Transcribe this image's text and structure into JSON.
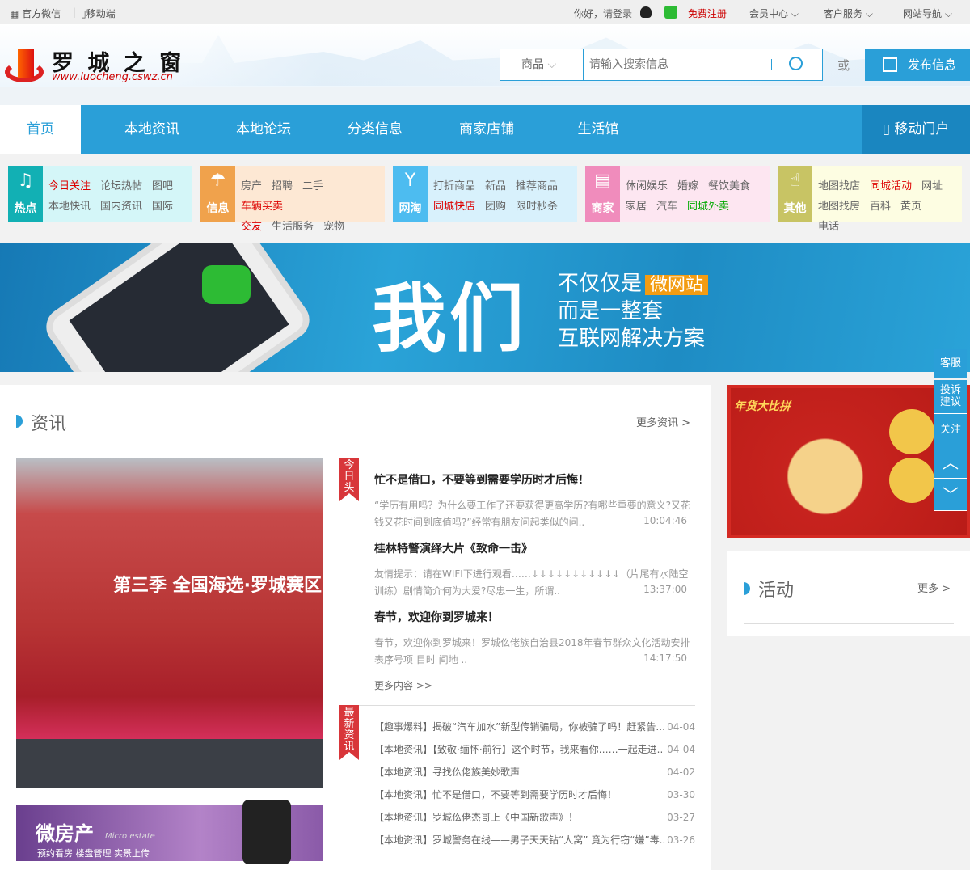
{
  "topbar": {
    "wechat": "官方微信",
    "mobile": "移动端",
    "greeting": "你好，请登录",
    "register": "免费注册",
    "member": "会员中心",
    "service": "客户服务",
    "sitenav": "网站导航"
  },
  "logo": {
    "name": "罗 城 之 窗",
    "url": "www.luocheng.cswz.cn"
  },
  "search": {
    "category": "商品",
    "placeholder": "请输入搜索信息",
    "or": "或",
    "publish": "发布信息"
  },
  "nav": {
    "items": [
      "首页",
      "本地资讯",
      "本地论坛",
      "分类信息",
      "商家店铺",
      "生活馆"
    ],
    "mobile": "移动门户"
  },
  "categories": [
    {
      "label": "热点",
      "links": [
        [
          "今日关注",
          "论坛热帖",
          "图吧"
        ],
        [
          "本地快讯",
          "国内资讯",
          "国际"
        ]
      ]
    },
    {
      "label": "信息",
      "links": [
        [
          "房产",
          "招聘",
          "二手",
          "车辆买卖"
        ],
        [
          "交友",
          "生活服务",
          "宠物"
        ]
      ]
    },
    {
      "label": "网淘",
      "links": [
        [
          "打折商品",
          "新品",
          "推荐商品"
        ],
        [
          "同城快店",
          "团购",
          "限时秒杀"
        ]
      ]
    },
    {
      "label": "商家",
      "links": [
        [
          "休闲娱乐",
          "婚嫁",
          "餐饮美食"
        ],
        [
          "家居",
          "汽车",
          "同城外卖"
        ]
      ]
    },
    {
      "label": "其他",
      "links": [
        [
          "地图找店",
          "同城活动",
          "网址"
        ],
        [
          "地图找房",
          "百科",
          "黄页",
          "电话"
        ]
      ]
    }
  ],
  "banner": {
    "big": "我们",
    "line1": "不仅仅是",
    "tag": "微网站",
    "line2": "而是一整套",
    "line3": "互联网解决方案"
  },
  "news": {
    "title": "资讯",
    "more": "更多资讯 >",
    "ribbon1": "今日头条",
    "ribbon2": "最新资讯",
    "headlines": [
      {
        "title": "忙不是借口，不要等到需要学历时才后悔！",
        "desc": "“学历有用吗？为什么要工作了还要获得更高学历?有哪些重要的意义?又花钱又花时间到底值吗?”经常有朋友问起类似的问..",
        "time": "10:04:46"
      },
      {
        "title": "桂林特警演绎大片《致命一击》",
        "desc": "友情提示：请在WIFI下进行观看……↓↓↓↓↓↓↓↓↓↓↓（片尾有水陆空训练）剧情简介何为大爱?尽忠一生，所谓..",
        "time": "13:37:00"
      },
      {
        "title": "春节，欢迎你到罗城来！",
        "desc": "春节，欢迎你到罗城来！罗城仫佬族自治县2018年春节群众文化活动安排表序号项 目时 间地 ..",
        "time": "14:17:50"
      }
    ],
    "more_content": "更多内容 >>",
    "latest": [
      {
        "text": "【趣事爆料】揭破“汽车加水”新型传销骗局，你被骗了吗！赶紧告...",
        "date": "04-04"
      },
      {
        "text": "【本地资讯】【致敬·缅怀·前行】这个时节，我来看你……一起走进..",
        "date": "04-04"
      },
      {
        "text": "【本地资讯】寻找仫佬族美妙歌声",
        "date": "04-02"
      },
      {
        "text": "【本地资讯】忙不是借口，不要等到需要学历时才后悔！",
        "date": "03-30"
      },
      {
        "text": "【本地资讯】罗城仫佬杰哥上《中国新歌声》！",
        "date": "03-27"
      },
      {
        "text": "【本地资讯】罗城警务在线——男子天天钻“人窝” 竟为行窃“嫌”毒..",
        "date": "03-26"
      }
    ],
    "photo_caption": "第三季 全国海选·罗城赛区",
    "ad2": {
      "title": "微房产",
      "sub": "Micro estate",
      "desc": "预约看房 楼盘管理 实景上传"
    }
  },
  "ad": {
    "title": "年货大比拼"
  },
  "activity": {
    "title": "活动",
    "more": "更多 >"
  },
  "float": {
    "service": "客服",
    "complain": "投诉建议",
    "follow": "关注"
  },
  "colors": {
    "blue": "#2a9fd8",
    "red": "#d8363a"
  }
}
